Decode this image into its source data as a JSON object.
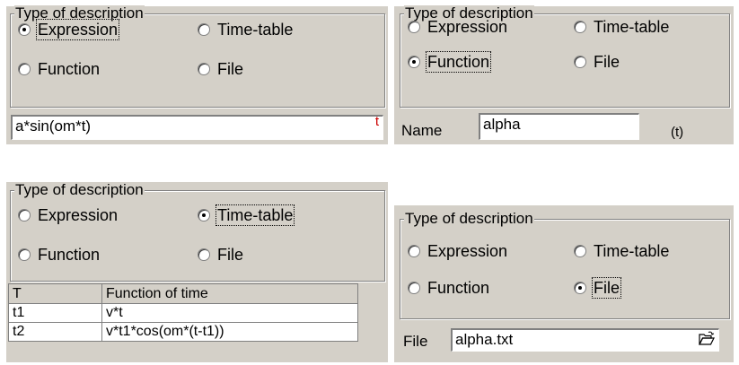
{
  "panels": {
    "expression": {
      "group_title": "Type of description",
      "options": {
        "expression": "Expression",
        "timetable": "Time-table",
        "function": "Function",
        "file": "File"
      },
      "selected": "Expression",
      "input_value": "a*sin(om*t)",
      "input_marker": "t"
    },
    "function": {
      "group_title": "Type of description",
      "options": {
        "expression": "Expression",
        "timetable": "Time-table",
        "function": "Function",
        "file": "File"
      },
      "selected": "Function",
      "name_label": "Name",
      "name_value": "alpha",
      "suffix": "(t)"
    },
    "timetable": {
      "group_title": "Type of description",
      "options": {
        "expression": "Expression",
        "timetable": "Time-table",
        "function": "Function",
        "file": "File"
      },
      "selected": "Time-table",
      "table": {
        "headers": [
          "T",
          "Function of time"
        ],
        "rows": [
          [
            "t1",
            "v*t"
          ],
          [
            "t2",
            "v*t1*cos(om*(t-t1))"
          ]
        ]
      }
    },
    "file": {
      "group_title": "Type of description",
      "options": {
        "expression": "Expression",
        "timetable": "Time-table",
        "function": "Function",
        "file": "File"
      },
      "selected": "File",
      "file_label": "File",
      "file_value": "alpha.txt",
      "browse_icon": "folder-open-icon"
    }
  }
}
